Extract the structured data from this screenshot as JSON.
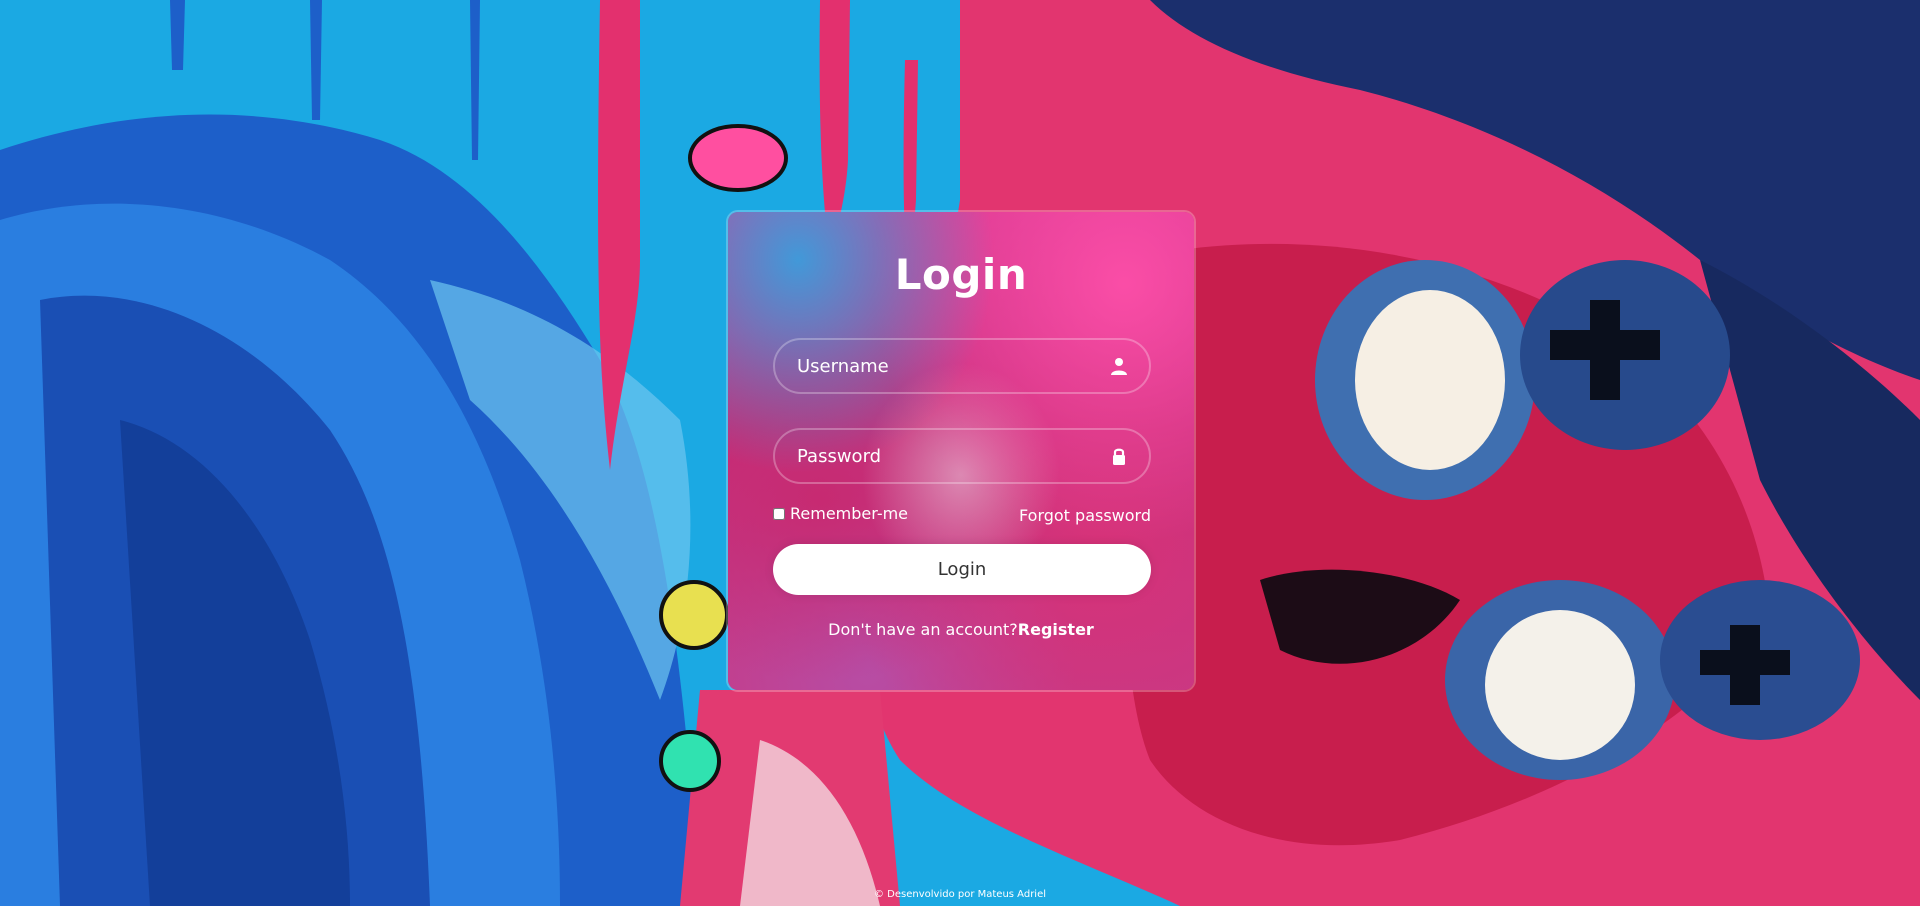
{
  "login_form": {
    "title": "Login",
    "username_placeholder": "Username",
    "password_placeholder": "Password",
    "remember_label": "Remember-me",
    "forgot_label": "Forgot password",
    "submit_label": "Login",
    "register_prompt": "Don't have an account?",
    "register_link": "Register"
  },
  "footer": {
    "text": "© Desenvolvido por Mateus Adriel"
  },
  "icons": {
    "username": "user-icon",
    "password": "lock-icon"
  },
  "colors": {
    "background_primary": "#1aa6e0",
    "accent_pink": "#e8306f",
    "button_bg": "#ffffff",
    "text": "#ffffff"
  }
}
